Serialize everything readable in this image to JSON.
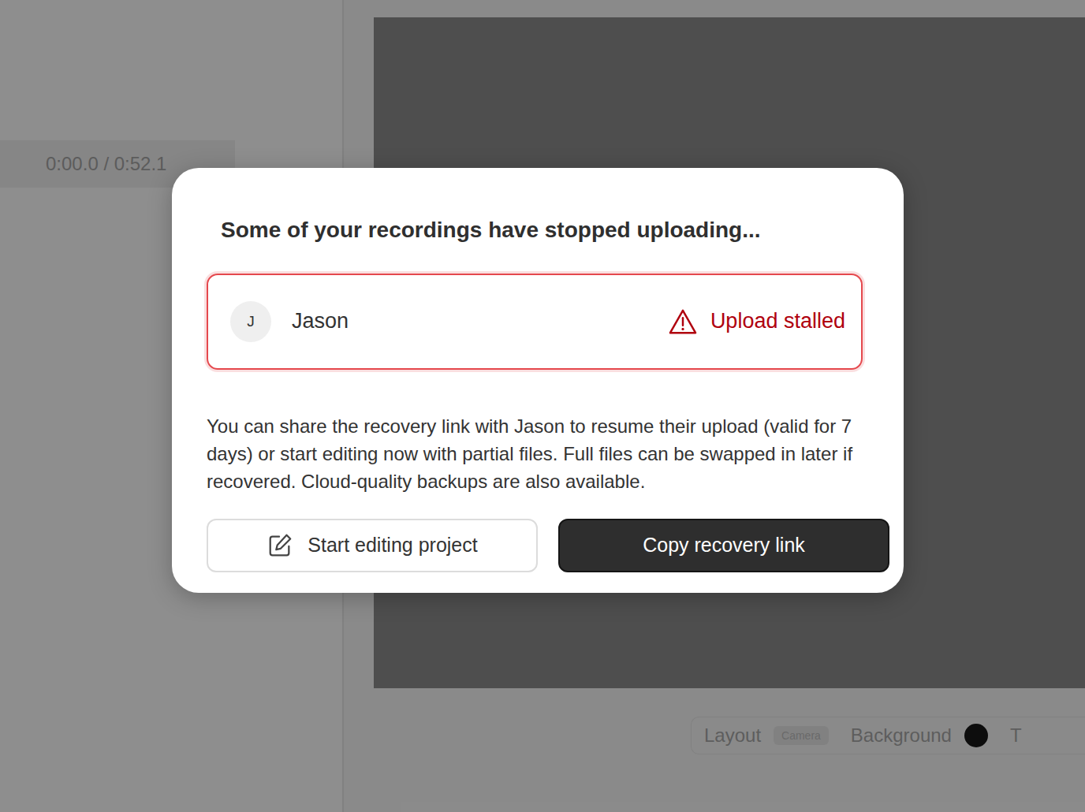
{
  "background": {
    "timecode": "0:00.0 / 0:52.1",
    "toolbar": {
      "layout_label": "Layout",
      "layout_value": "Camera",
      "background_label": "Background",
      "background_color": "#000000",
      "next_label": "T"
    }
  },
  "modal": {
    "title": "Some of your recordings have stopped uploading...",
    "recordings": [
      {
        "initial": "J",
        "name": "Jason",
        "status": "Upload stalled",
        "stalled": true
      }
    ],
    "message": "You can share the recovery link with Jason to resume their upload (valid for 7 days) or start editing now with partial files. Full files can be swapped in later if recovered. Cloud-quality backups are also available.",
    "buttons": [
      {
        "label": "Start editing project",
        "kind": "secondary"
      },
      {
        "label": "Copy recovery link",
        "kind": "primary"
      }
    ]
  }
}
